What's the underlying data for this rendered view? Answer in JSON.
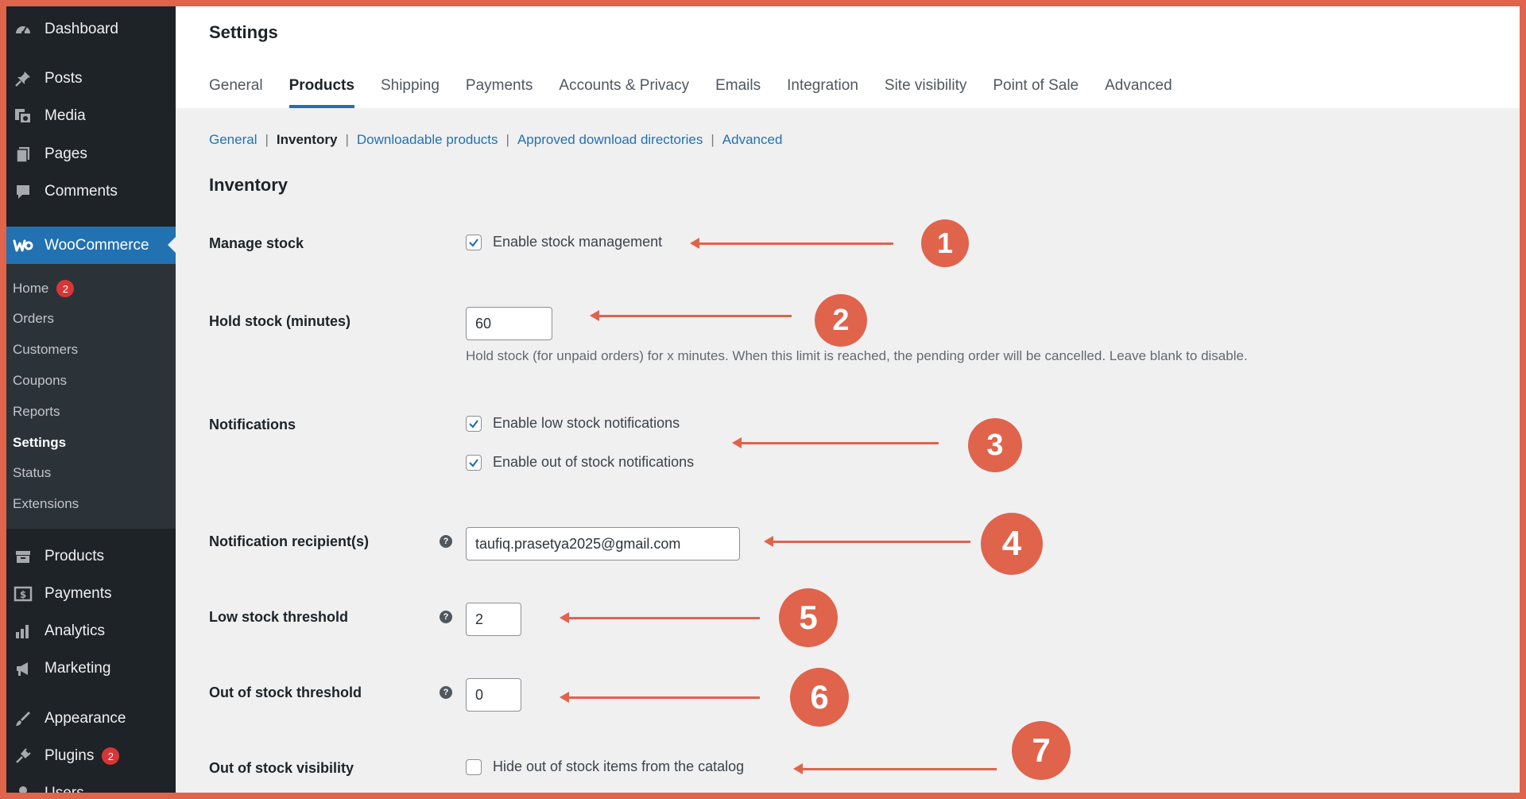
{
  "sidebar": {
    "dashboard": "Dashboard",
    "posts": "Posts",
    "media": "Media",
    "pages": "Pages",
    "comments": "Comments",
    "woocommerce": "WooCommerce",
    "submenu": {
      "home": "Home",
      "home_badge": "2",
      "orders": "Orders",
      "customers": "Customers",
      "coupons": "Coupons",
      "reports": "Reports",
      "settings": "Settings",
      "status": "Status",
      "extensions": "Extensions"
    },
    "products": "Products",
    "payments": "Payments",
    "analytics": "Analytics",
    "marketing": "Marketing",
    "appearance": "Appearance",
    "plugins": "Plugins",
    "plugins_badge": "2",
    "users": "Users"
  },
  "header": {
    "title": "Settings",
    "tabs": [
      "General",
      "Products",
      "Shipping",
      "Payments",
      "Accounts & Privacy",
      "Emails",
      "Integration",
      "Site visibility",
      "Point of Sale",
      "Advanced"
    ]
  },
  "subnav": {
    "general": "General",
    "inventory": "Inventory",
    "downloadable": "Downloadable products",
    "approved": "Approved download directories",
    "advanced": "Advanced",
    "separator": "|"
  },
  "section_title": "Inventory",
  "form": {
    "manage_stock_label": "Manage stock",
    "manage_stock_option": "Enable stock management",
    "manage_stock_checked": true,
    "hold_stock_label": "Hold stock (minutes)",
    "hold_stock_value": "60",
    "hold_stock_desc": "Hold stock (for unpaid orders) for x minutes. When this limit is reached, the pending order will be cancelled. Leave blank to disable.",
    "notifications_label": "Notifications",
    "low_stock_notif": "Enable low stock notifications",
    "low_stock_notif_checked": true,
    "out_stock_notif": "Enable out of stock notifications",
    "out_stock_notif_checked": true,
    "recipient_label": "Notification recipient(s)",
    "recipient_value": "taufiq.prasetya2025@gmail.com",
    "low_threshold_label": "Low stock threshold",
    "low_threshold_value": "2",
    "out_threshold_label": "Out of stock threshold",
    "out_threshold_value": "0",
    "visibility_label": "Out of stock visibility",
    "visibility_option": "Hide out of stock items from the catalog",
    "visibility_checked": false,
    "help_glyph": "?"
  },
  "annotations": [
    "1",
    "2",
    "3",
    "4",
    "5",
    "6",
    "7"
  ],
  "colors": {
    "accent": "#2271b1",
    "annotation": "#e0634c",
    "sidebar_bg": "#1d2327"
  }
}
